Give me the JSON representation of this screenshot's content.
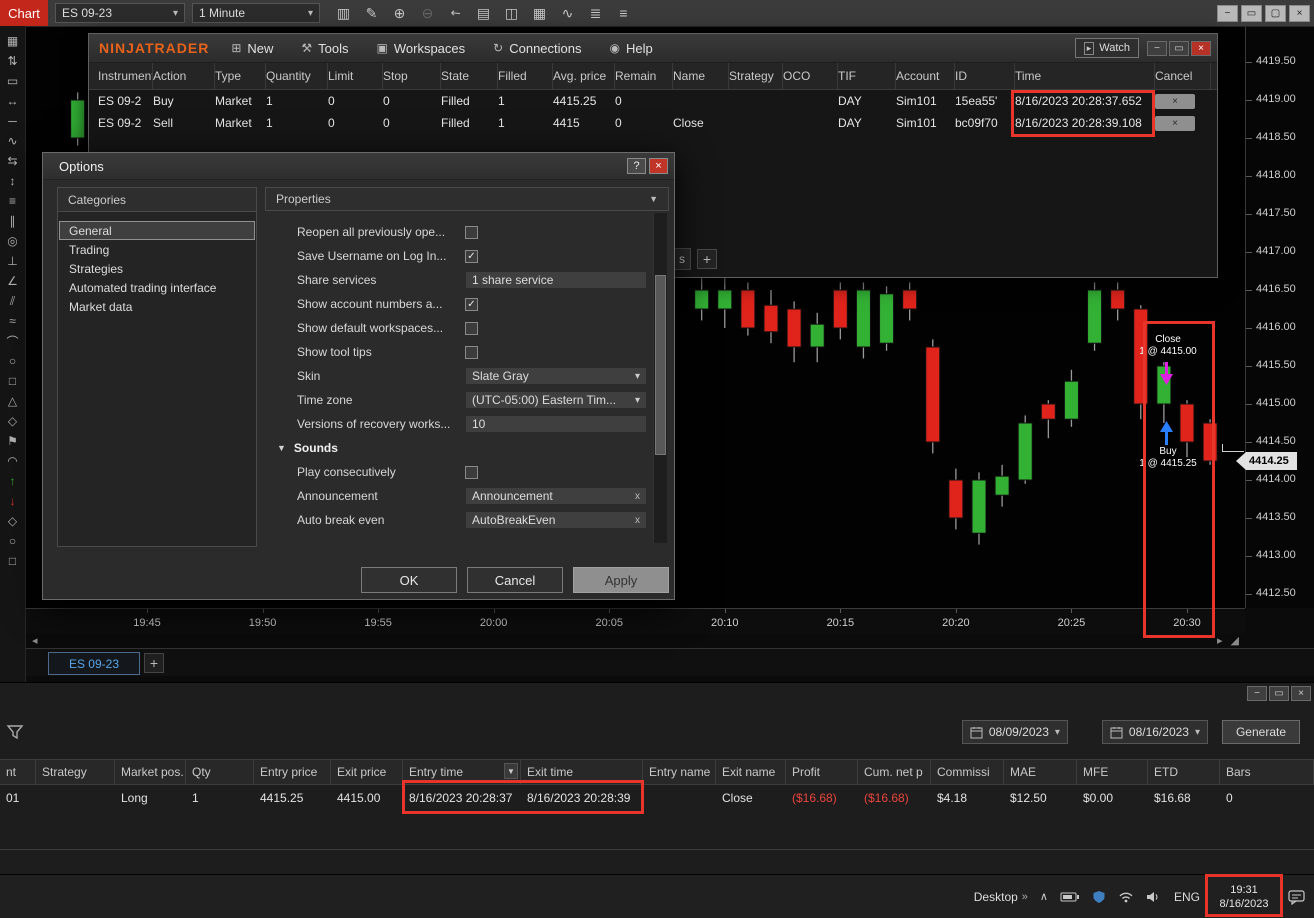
{
  "colors": {
    "highlight_box": "#e8352b",
    "candle_up": "#33b135",
    "candle_down": "#e0241c",
    "logo_orange": "#e8621a",
    "tab_blue": "#58a6e8",
    "loss_red": "#e8453c",
    "buy_arrow_blue": "#2a7fff",
    "close_arrow_magenta": "#e020e0",
    "price_tag_bg": "#e2e2e2"
  },
  "topbar": {
    "window_label": "Chart",
    "instrument_value": "ES 09-23",
    "interval_value": "1 Minute",
    "icons": [
      "bar-type-icon",
      "draw-icon",
      "zoom-in-icon",
      "zoom-out-icon",
      "cursor-icon",
      "report-icon",
      "split-window-icon",
      "chart-trader-icon",
      "indicator-icon",
      "data-grid-icon",
      "list-icon"
    ],
    "window_buttons": [
      "minimize",
      "restore",
      "maximize",
      "close"
    ]
  },
  "left_toolbar": {
    "tools": [
      "grid-tool",
      "vertical-range-tool",
      "region-tool",
      "horizontal-line-tool",
      "line-tool",
      "wave-tool",
      "swap-tool",
      "vertical-line-tool",
      "levels-tool",
      "bars-pattern-tool",
      "fibonacci-circle-tool",
      "gann-tool",
      "angle-tool",
      "parallel-channel-tool",
      "zigzag-tool",
      "arc-tool",
      "ellipse-tool",
      "rectangle-tool",
      "triangle-tool",
      "polygon-tool",
      "flag-tool",
      "curve-tool",
      "buy-marker-tool",
      "sell-marker-tool",
      "diamond-marker-tool",
      "circle-marker-tool",
      "square-marker-tool"
    ]
  },
  "orders_window": {
    "logo": "NINJATRADER",
    "menus": [
      "New",
      "Tools",
      "Workspaces",
      "Connections",
      "Help"
    ],
    "watch_label": "Watch",
    "cancel_icon": "×",
    "tab_partial": "s",
    "tab_add": "+",
    "table": {
      "columns": [
        "Instrument",
        "Action",
        "Type",
        "Quantity",
        "Limit",
        "Stop",
        "State",
        "Filled",
        "Avg. price",
        "Remain",
        "Name",
        "Strategy",
        "OCO",
        "TIF",
        "Account",
        "ID",
        "Time",
        "Cancel"
      ],
      "rows": [
        [
          "ES 09-2",
          "Buy",
          "Market",
          "1",
          "0",
          "0",
          "Filled",
          "1",
          "4415.25",
          "0",
          "",
          "",
          "",
          "DAY",
          "Sim101",
          "15ea55'",
          "8/16/2023 20:28:37.652"
        ],
        [
          "ES 09-2",
          "Sell",
          "Market",
          "1",
          "0",
          "0",
          "Filled",
          "1",
          "4415",
          "0",
          "Close",
          "",
          "",
          "DAY",
          "Sim101",
          "bc09f70",
          "8/16/2023 20:28:39.108"
        ]
      ]
    }
  },
  "options_dialog": {
    "title": "Options",
    "help_button": "?",
    "close_button": "×",
    "categories_header": "Categories",
    "categories": [
      "General",
      "Trading",
      "Strategies",
      "Automated trading interface",
      "Market data"
    ],
    "selected_category": "General",
    "properties_header": "Properties",
    "properties": [
      {
        "label": "Reopen all previously ope...",
        "type": "checkbox",
        "checked": false
      },
      {
        "label": "Save Username on Log In...",
        "type": "checkbox",
        "checked": true
      },
      {
        "label": "Share services",
        "type": "text",
        "value": "1 share service"
      },
      {
        "label": "Show account numbers a...",
        "type": "checkbox",
        "checked": true
      },
      {
        "label": "Show default workspaces...",
        "type": "checkbox",
        "checked": false
      },
      {
        "label": "Show tool tips",
        "type": "checkbox",
        "checked": false
      },
      {
        "label": "Skin",
        "type": "select",
        "value": "Slate Gray"
      },
      {
        "label": "Time zone",
        "type": "select",
        "value": "(UTC-05:00) Eastern Tim..."
      },
      {
        "label": "Versions of recovery works...",
        "type": "text",
        "value": "10"
      },
      {
        "label": "Sounds",
        "type": "group"
      },
      {
        "label": "Play consecutively",
        "type": "checkbox",
        "checked": false
      },
      {
        "label": "Announcement",
        "type": "clearable",
        "value": "Announcement"
      },
      {
        "label": "Auto break even",
        "type": "clearable",
        "value": "AutoBreakEven"
      }
    ],
    "buttons": [
      "OK",
      "Cancel",
      "Apply"
    ]
  },
  "chart_data": {
    "type": "candlestick",
    "instrument_tab": "ES 09-23",
    "tab_add": "+",
    "current_price": "4414.25",
    "y_labels": [
      "4419.50",
      "4419.00",
      "4418.50",
      "4418.00",
      "4417.50",
      "4417.00",
      "4416.50",
      "4416.00",
      "4415.50",
      "4415.00",
      "4414.50",
      "4414.00",
      "4413.50",
      "4413.00",
      "4412.50"
    ],
    "x_labels": [
      "19:45",
      "19:50",
      "19:55",
      "20:00",
      "20:05",
      "20:10",
      "20:15",
      "20:20",
      "20:25",
      "20:30"
    ],
    "ylim": [
      4412.25,
      4419.75
    ],
    "candles": [
      {
        "t": "19:42",
        "o": 4418.5,
        "h": 4419.1,
        "l": 4418.4,
        "c": 4419.0
      },
      {
        "t": "20:09",
        "o": 4416.25,
        "h": 4416.7,
        "l": 4416.1,
        "c": 4416.5
      },
      {
        "t": "20:10",
        "o": 4416.25,
        "h": 4416.7,
        "l": 4416.0,
        "c": 4416.5
      },
      {
        "t": "20:11",
        "o": 4416.5,
        "h": 4416.6,
        "l": 4415.9,
        "c": 4416.0
      },
      {
        "t": "20:12",
        "o": 4416.3,
        "h": 4416.5,
        "l": 4415.8,
        "c": 4415.95
      },
      {
        "t": "20:13",
        "o": 4416.25,
        "h": 4416.35,
        "l": 4415.55,
        "c": 4415.75
      },
      {
        "t": "20:14",
        "o": 4415.75,
        "h": 4416.2,
        "l": 4415.55,
        "c": 4416.05
      },
      {
        "t": "20:15",
        "o": 4416.5,
        "h": 4416.6,
        "l": 4415.85,
        "c": 4416.0
      },
      {
        "t": "20:16",
        "o": 4415.75,
        "h": 4416.6,
        "l": 4415.6,
        "c": 4416.5
      },
      {
        "t": "20:17",
        "o": 4415.8,
        "h": 4416.55,
        "l": 4415.7,
        "c": 4416.45
      },
      {
        "t": "20:18",
        "o": 4416.5,
        "h": 4416.6,
        "l": 4416.1,
        "c": 4416.25
      },
      {
        "t": "20:19",
        "o": 4415.75,
        "h": 4415.85,
        "l": 4414.35,
        "c": 4414.5
      },
      {
        "t": "20:20",
        "o": 4414.0,
        "h": 4414.15,
        "l": 4413.35,
        "c": 4413.5
      },
      {
        "t": "20:21",
        "o": 4413.3,
        "h": 4414.1,
        "l": 4413.15,
        "c": 4414.0
      },
      {
        "t": "20:22",
        "o": 4413.8,
        "h": 4414.2,
        "l": 4413.65,
        "c": 4414.05
      },
      {
        "t": "20:23",
        "o": 4414.0,
        "h": 4414.85,
        "l": 4413.95,
        "c": 4414.75
      },
      {
        "t": "20:24",
        "o": 4415.0,
        "h": 4415.05,
        "l": 4414.55,
        "c": 4414.8
      },
      {
        "t": "20:25",
        "o": 4414.8,
        "h": 4415.45,
        "l": 4414.7,
        "c": 4415.3
      },
      {
        "t": "20:26",
        "o": 4415.8,
        "h": 4416.6,
        "l": 4415.7,
        "c": 4416.5
      },
      {
        "t": "20:27",
        "o": 4416.5,
        "h": 4416.6,
        "l": 4416.1,
        "c": 4416.25
      },
      {
        "t": "20:28",
        "o": 4416.25,
        "h": 4416.3,
        "l": 4414.8,
        "c": 4415.0
      },
      {
        "t": "20:29",
        "o": 4415.0,
        "h": 4415.55,
        "l": 4414.75,
        "c": 4415.5
      },
      {
        "t": "20:30",
        "o": 4415.0,
        "h": 4415.05,
        "l": 4414.3,
        "c": 4414.5
      },
      {
        "t": "20:31",
        "o": 4414.75,
        "h": 4414.8,
        "l": 4414.2,
        "c": 4414.25
      }
    ],
    "annotations": {
      "close_line1": "Close",
      "close_line2": "1 @ 4415.00",
      "buy_line1": "Buy",
      "buy_line2": "1 @ 4415.25"
    }
  },
  "trades_panel": {
    "date_from": "08/09/2023",
    "date_to": "08/16/2023",
    "generate_label": "Generate",
    "columns": [
      "nt",
      "Strategy",
      "Market pos.",
      "Qty",
      "Entry price",
      "Exit price",
      "Entry time",
      "Exit time",
      "Entry name",
      "Exit name",
      "Profit",
      "Cum. net p",
      "Commissi",
      "MAE",
      "MFE",
      "ETD",
      "Bars"
    ],
    "row": [
      "01",
      "",
      "Long",
      "1",
      "4415.25",
      "4415.00",
      "8/16/2023 20:28:37",
      "8/16/2023 20:28:39",
      "",
      "Close",
      "($16.68)",
      "($16.68)",
      "$4.18",
      "$12.50",
      "$0.00",
      "$16.68",
      "0"
    ]
  },
  "taskbar": {
    "desktop_label": "Desktop",
    "language": "ENG",
    "time": "19:31",
    "date": "8/16/2023",
    "icons": [
      "hidden-icons",
      "battery",
      "shield",
      "network",
      "speaker",
      "notifications"
    ]
  }
}
